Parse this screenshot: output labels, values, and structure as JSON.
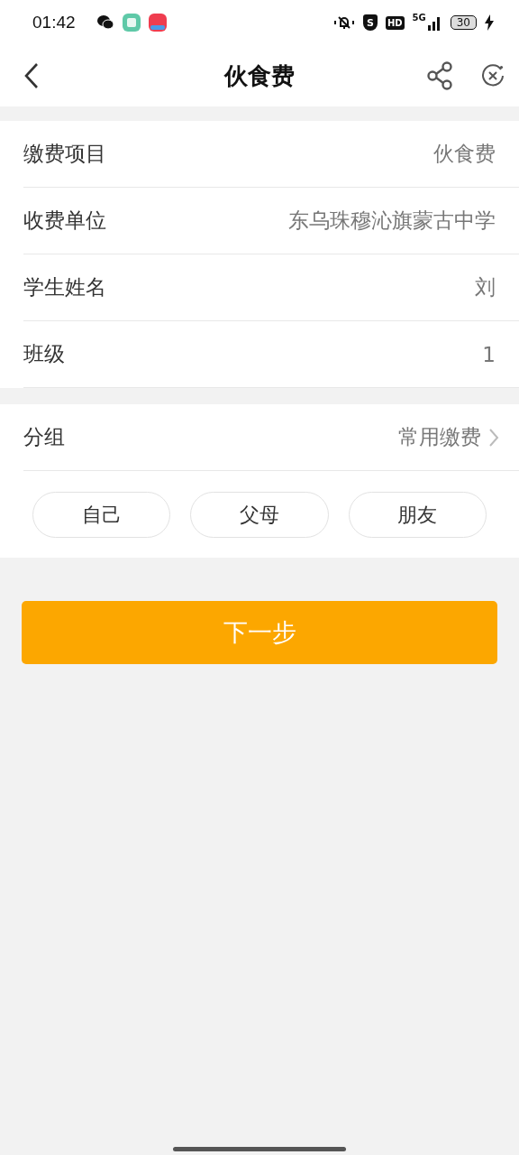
{
  "status_bar": {
    "time": "01:42",
    "shield_label": "S",
    "hd_label": "HD",
    "network": "5G",
    "battery": "30"
  },
  "header": {
    "title": "伙食费"
  },
  "details": [
    {
      "label": "缴费项目",
      "value": "伙食费"
    },
    {
      "label": "收费单位",
      "value": "东乌珠穆沁旗蒙古中学"
    },
    {
      "label": "学生姓名",
      "value": "刘"
    },
    {
      "label": "班级",
      "value": "1"
    }
  ],
  "group": {
    "label": "分组",
    "value": "常用缴费"
  },
  "chips": [
    {
      "label": "自己",
      "selected": false
    },
    {
      "label": "父母",
      "selected": false
    },
    {
      "label": "朋友",
      "selected": false
    }
  ],
  "next_button": "下一步"
}
